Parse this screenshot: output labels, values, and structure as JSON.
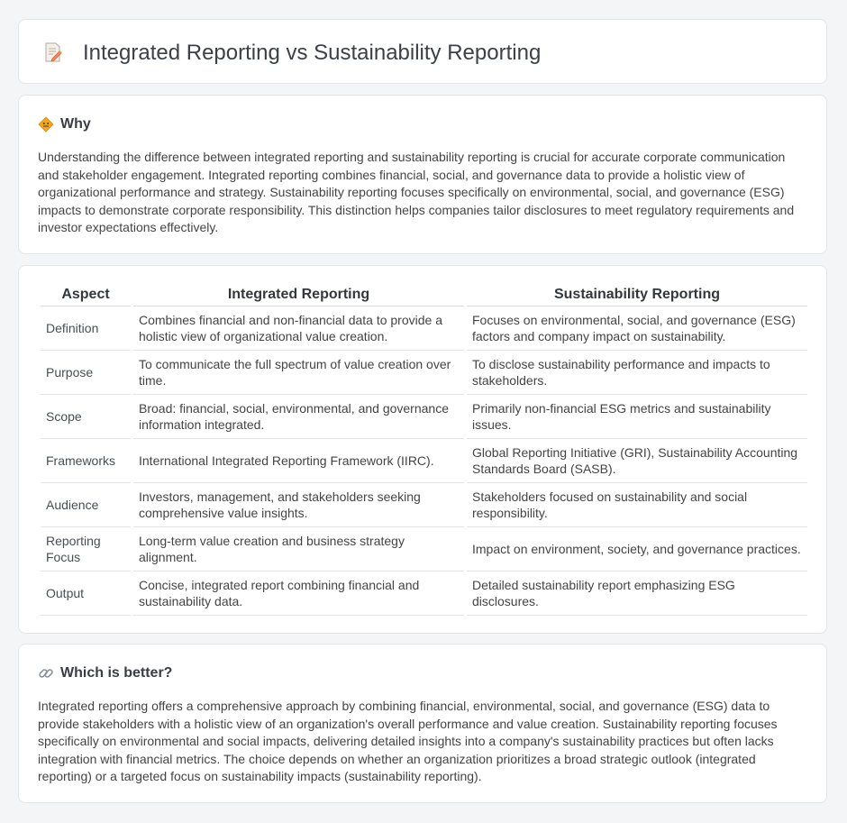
{
  "page": {
    "title": "Integrated Reporting vs Sustainability Reporting"
  },
  "why": {
    "heading": "Why",
    "text": "Understanding the difference between integrated reporting and sustainability reporting is crucial for accurate corporate communication and stakeholder engagement. Integrated reporting combines financial, social, and governance data to provide a holistic view of organizational performance and strategy. Sustainability reporting focuses specifically on environmental, social, and governance (ESG) impacts to demonstrate corporate responsibility. This distinction helps companies tailor disclosures to meet regulatory requirements and investor expectations effectively."
  },
  "comparison": {
    "headers": [
      "Aspect",
      "Integrated Reporting",
      "Sustainability Reporting"
    ],
    "rows": [
      [
        "Definition",
        "Combines financial and non-financial data to provide a holistic view of organizational value creation.",
        "Focuses on environmental, social, and governance (ESG) factors and company impact on sustainability."
      ],
      [
        "Purpose",
        "To communicate the full spectrum of value creation over time.",
        "To disclose sustainability performance and impacts to stakeholders."
      ],
      [
        "Scope",
        "Broad: financial, social, environmental, and governance information integrated.",
        "Primarily non-financial ESG metrics and sustainability issues."
      ],
      [
        "Frameworks",
        "International Integrated Reporting Framework (IIRC).",
        "Global Reporting Initiative (GRI), Sustainability Accounting Standards Board (SASB)."
      ],
      [
        "Audience",
        "Investors, management, and stakeholders seeking comprehensive value insights.",
        "Stakeholders focused on sustainability and social responsibility."
      ],
      [
        "Reporting Focus",
        "Long-term value creation and business strategy alignment.",
        "Impact on environment, society, and governance practices."
      ],
      [
        "Output",
        "Concise, integrated report combining financial and sustainability data.",
        "Detailed sustainability report emphasizing ESG disclosures."
      ]
    ]
  },
  "better": {
    "heading": "Which is better?",
    "text": "Integrated reporting offers a comprehensive approach by combining financial, environmental, social, and governance (ESG) data to provide stakeholders with a holistic view of an organization's overall performance and value creation. Sustainability reporting focuses specifically on environmental and social impacts, delivering detailed insights into a company's sustainability practices but often lacks integration with financial metrics. The choice depends on whether an organization prioritizes a broad strategic outlook (integrated reporting) or a targeted focus on sustainability impacts (sustainability reporting)."
  },
  "icons": {
    "title": "memo-pencil-icon",
    "why": "warning-sign-icon",
    "better": "link-icon"
  },
  "colors": {
    "background": "#f4f5f7",
    "card": "#ffffff",
    "border": "#e3e5e8",
    "title_text": "#3c4048",
    "body_text": "#444444"
  }
}
